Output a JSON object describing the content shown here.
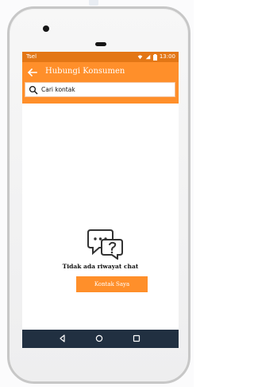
{
  "status_bar": {
    "carrier": "Tsel",
    "time": "13:00",
    "icons": [
      "wifi-icon",
      "signal-icon",
      "battery-icon"
    ]
  },
  "header": {
    "back_icon": "arrow-left-icon",
    "title": "Hubungi Konsumen"
  },
  "search": {
    "icon": "search-icon",
    "placeholder": "Cari kontak",
    "value": ""
  },
  "empty_state": {
    "icon": "chat-question-icon",
    "message": "Tidak ada riwayat chat",
    "button_label": "Kontak Saya"
  },
  "navigation": {
    "items": [
      "back-triangle-icon",
      "home-circle-icon",
      "recent-square-icon"
    ]
  },
  "colors": {
    "status_bar": "#e37716",
    "app_bar": "#ff8f2a",
    "nav_bar": "#213041",
    "button": "#ff8f2a"
  }
}
